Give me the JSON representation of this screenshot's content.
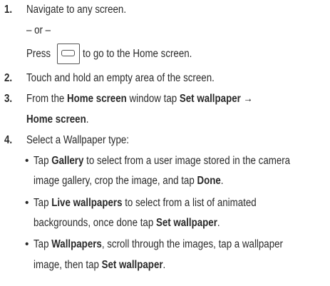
{
  "steps": [
    {
      "number": "1.",
      "text": "Navigate to any screen."
    },
    {
      "number": "2.",
      "text": "Touch and hold an empty area of the screen."
    },
    {
      "number": "3.",
      "parts": [
        "From the ",
        "Home screen",
        " window tap ",
        "Set wallpaper",
        " →",
        "Home screen",
        "."
      ]
    },
    {
      "number": "4.",
      "text": "Select a Wallpaper type:"
    }
  ],
  "or_text": "– or –",
  "press": {
    "before": "Press",
    "after": "to go to the Home screen.",
    "icon": "home-key-icon"
  },
  "bullets": [
    {
      "symbol": "•",
      "l1": [
        "Tap ",
        "Gallery",
        " to select from a user image stored in the camera"
      ],
      "l2": [
        "image gallery, crop the image, and tap ",
        "Done",
        "."
      ]
    },
    {
      "symbol": "•",
      "l1": [
        "Tap ",
        "Live wallpapers",
        " to select from a list of animated"
      ],
      "l2": [
        "backgrounds, once done tap ",
        "Set wallpaper",
        "."
      ]
    },
    {
      "symbol": "•",
      "l1": [
        "Tap ",
        "Wallpapers",
        ", scroll through the images, tap a wallpaper"
      ],
      "l2": [
        "image, then tap ",
        "Set wallpaper",
        "."
      ]
    }
  ]
}
